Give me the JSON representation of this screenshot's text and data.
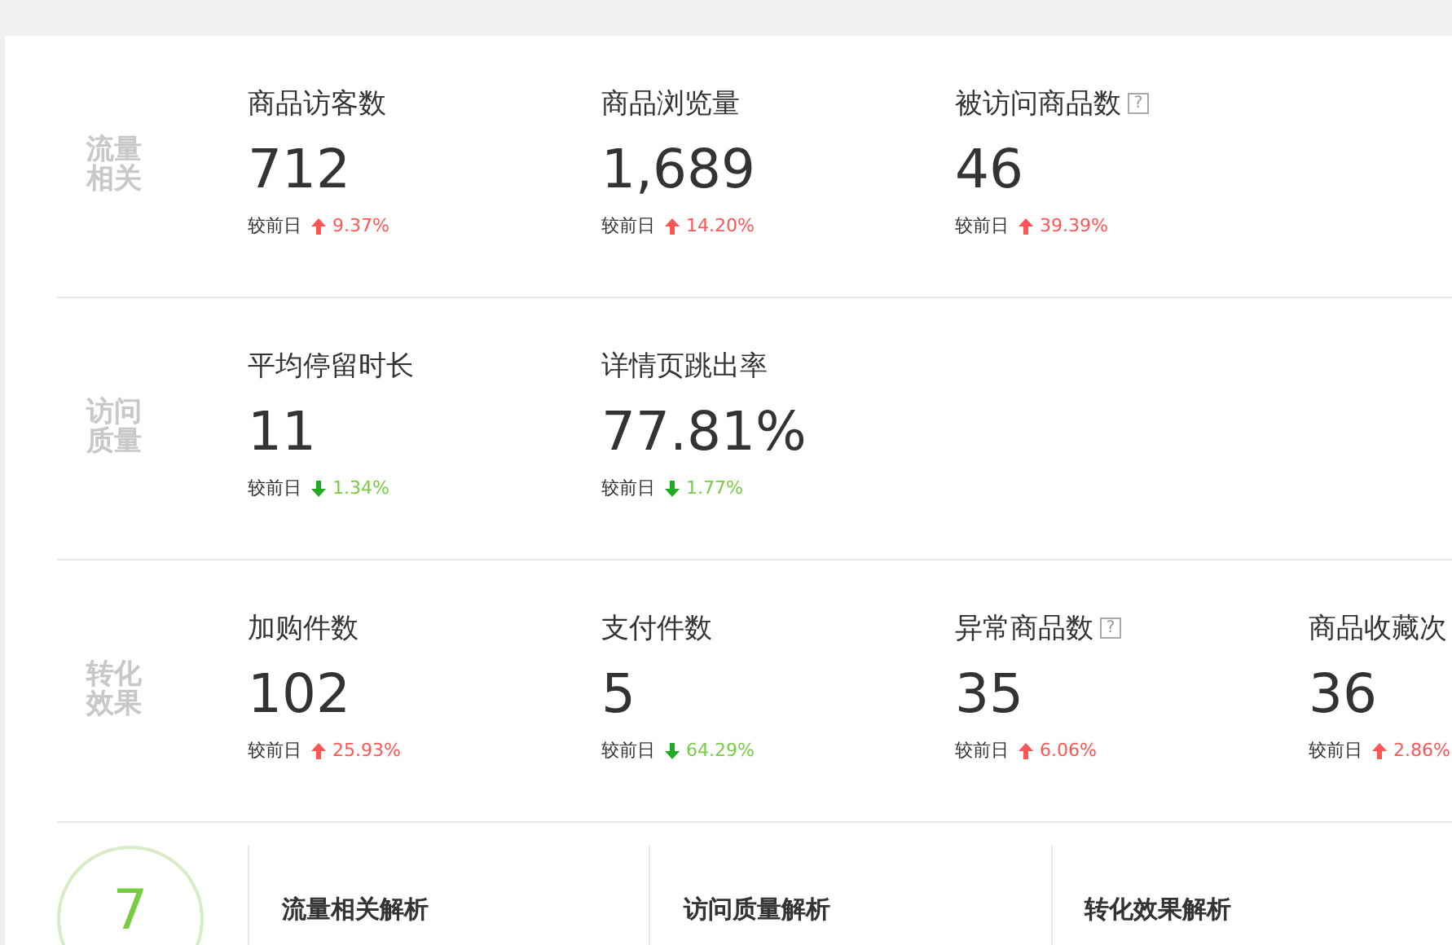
{
  "sections": [
    {
      "label": "流量相关",
      "metrics": [
        {
          "title": "商品访客数",
          "value": "712",
          "compare": "较前日",
          "rising": true,
          "change": "9.37%"
        },
        {
          "title": "商品浏览量",
          "value": "1,689",
          "compare": "较前日",
          "rising": true,
          "change": "14.20%"
        },
        {
          "title": "被访问商品数",
          "help_icon": "?",
          "value": "46",
          "compare": "较前日",
          "rising": true,
          "change": "39.39%"
        }
      ]
    },
    {
      "label": "访问质量",
      "metrics": [
        {
          "title": "平均停留时长",
          "value": "11",
          "compare": "较前日",
          "rising": false,
          "change": "1.34%"
        },
        {
          "title": "详情页跳出率",
          "value": "77.81%",
          "compare": "较前日",
          "rising": false,
          "change": "1.77%"
        }
      ]
    },
    {
      "label": "转化效果",
      "metrics": [
        {
          "title": "加购件数",
          "value": "102",
          "compare": "较前日",
          "rising": true,
          "change": "25.93%"
        },
        {
          "title": "支付件数",
          "value": "5",
          "compare": "较前日",
          "rising": false,
          "change": "64.29%"
        },
        {
          "title": "异常商品数",
          "help_icon": "?",
          "value": "35",
          "compare": "较前日",
          "rising": true,
          "change": "6.06%"
        },
        {
          "title": "商品收藏次",
          "value": "36",
          "compare": "较前日",
          "rising": true,
          "change": "2.86%"
        }
      ]
    }
  ],
  "analysis": {
    "score": "7",
    "headings": [
      "流量相关解析",
      "访问质量解析",
      "转化效果解析"
    ]
  }
}
